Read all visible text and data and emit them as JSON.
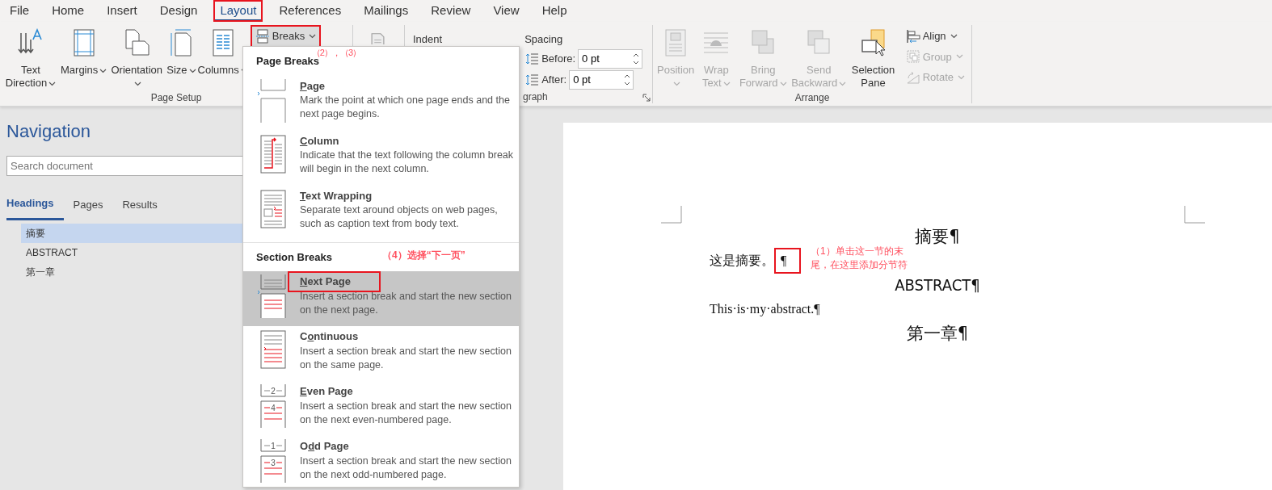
{
  "menu_tabs": [
    {
      "label": "File",
      "selected": false,
      "highlighted": false
    },
    {
      "label": "Home",
      "selected": false,
      "highlighted": false
    },
    {
      "label": "Insert",
      "selected": false,
      "highlighted": false
    },
    {
      "label": "Design",
      "selected": false,
      "highlighted": false
    },
    {
      "label": "Layout",
      "selected": true,
      "highlighted": true
    },
    {
      "label": "References",
      "selected": false,
      "highlighted": false
    },
    {
      "label": "Mailings",
      "selected": false,
      "highlighted": false
    },
    {
      "label": "Review",
      "selected": false,
      "highlighted": false
    },
    {
      "label": "View",
      "selected": false,
      "highlighted": false
    },
    {
      "label": "Help",
      "selected": false,
      "highlighted": false
    }
  ],
  "ribbon": {
    "groups": [
      {
        "label": "Page Setup",
        "items": [
          {
            "kind": "large",
            "label": "Text Direction",
            "dropdown": true,
            "disabled": false
          },
          {
            "kind": "large",
            "label": "Margins",
            "dropdown": true,
            "disabled": false
          },
          {
            "kind": "large",
            "label": "Orientation",
            "dropdown": true,
            "disabled": false
          },
          {
            "kind": "large",
            "label": "Size",
            "dropdown": true,
            "disabled": false
          },
          {
            "kind": "large",
            "label": "Columns",
            "dropdown": true,
            "disabled": false
          },
          {
            "kind": "stack",
            "buttons": [
              {
                "label": "Breaks",
                "dropdown": true,
                "disabled": false,
                "highlighted": true,
                "note": "（2），（3）"
              }
            ]
          }
        ]
      },
      {
        "items": [
          {
            "kind": "icon",
            "disabled": true
          }
        ]
      },
      {
        "label": "graph",
        "launcher": true,
        "items": [
          {
            "kind": "heading",
            "label": "Indent"
          },
          {
            "kind": "spacing",
            "label": "Spacing",
            "fields": [
              {
                "label": "Before:",
                "value": "0 pt"
              },
              {
                "label": "After:",
                "value": "0 pt"
              }
            ]
          }
        ]
      },
      {
        "label": "Arrange",
        "items": [
          {
            "kind": "large",
            "label": "Position",
            "dropdown": true,
            "disabled": true
          },
          {
            "kind": "large",
            "label": "Wrap Text",
            "dropdown": true,
            "disabled": true
          },
          {
            "kind": "large",
            "label": "Bring Forward",
            "dropdown": true,
            "disabled": true
          },
          {
            "kind": "large",
            "label": "Send Backward",
            "dropdown": true,
            "disabled": true
          },
          {
            "kind": "large",
            "label": "Selection Pane",
            "dropdown": false,
            "disabled": false
          },
          {
            "kind": "stack",
            "buttons": [
              {
                "label": "Align",
                "dropdown": true,
                "disabled": false,
                "highlighted": false
              },
              {
                "label": "Group",
                "dropdown": true,
                "disabled": true,
                "highlighted": false
              },
              {
                "label": "Rotate",
                "dropdown": true,
                "disabled": true,
                "highlighted": false
              }
            ]
          }
        ]
      }
    ]
  },
  "navigation": {
    "title": "Navigation",
    "search": {
      "placeholder": "Search document"
    },
    "tabs": [
      {
        "label": "Headings",
        "selected": true
      },
      {
        "label": "Pages",
        "selected": false
      },
      {
        "label": "Results",
        "selected": false
      }
    ],
    "headings": [
      {
        "label": "摘要",
        "selected": true
      },
      {
        "label": "ABSTRACT",
        "selected": false
      },
      {
        "label": "第一章",
        "selected": false
      }
    ]
  },
  "breaks_menu": {
    "sections": [
      {
        "title": "Page Breaks",
        "items": [
          {
            "kind": "page",
            "title_key": "P",
            "title_after": "age",
            "description": "Mark the point at which one page ends and the next page begins.",
            "selected": false,
            "highlighted": false
          },
          {
            "kind": "column",
            "title_key": "C",
            "title_after": "olumn",
            "description": "Indicate that the text following the column break will begin in the next column.",
            "selected": false,
            "highlighted": false
          },
          {
            "kind": "text-wrapping",
            "title_key": "T",
            "title_after": "ext Wrapping",
            "description": "Separate text around objects on web pages, such as caption text from body text.",
            "selected": false,
            "highlighted": false
          }
        ]
      },
      {
        "title": "Section Breaks",
        "note": "（4）选择“下一页”",
        "items": [
          {
            "kind": "next-page",
            "title_key": "N",
            "title_after": "ext Page",
            "description": "Insert a section break and start the new section on the next page.",
            "selected": true,
            "highlighted": true
          },
          {
            "kind": "continuous",
            "title_before": "C",
            "title_key": "o",
            "title_after": "ntinuous",
            "description": "Insert a section break and start the new section on the same page.",
            "selected": false,
            "highlighted": false
          },
          {
            "kind": "even-page",
            "title_key": "E",
            "title_after": "ven Page",
            "description": "Insert a section break and start the new section on the next even-numbered page.",
            "selected": false,
            "highlighted": false,
            "icon_numbers": [
              "2",
              "4"
            ]
          },
          {
            "kind": "odd-page",
            "title_before": "O",
            "title_key": "d",
            "title_after": "d Page",
            "description": "Insert a section break and start the new section on the next odd-numbered page.",
            "selected": false,
            "highlighted": false,
            "icon_numbers": [
              "1",
              "3"
            ]
          }
        ]
      }
    ]
  },
  "document": {
    "lines": [
      {
        "kind": "heading",
        "text": "摘要¶"
      },
      {
        "kind": "body-cjk",
        "text": "这是摘要。",
        "mark": "¶",
        "mark_highlighted": true,
        "note": "（1）单击这一节的末尾，在这里添加分节符"
      },
      {
        "kind": "heading-latin",
        "text": "ABSTRACT¶"
      },
      {
        "kind": "body",
        "text": "This·is·my·abstract.¶"
      },
      {
        "kind": "heading",
        "text": "第一章¶"
      }
    ]
  }
}
